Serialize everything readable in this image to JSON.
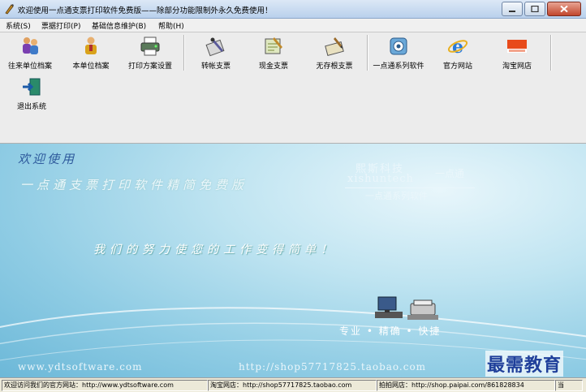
{
  "window": {
    "title": "欢迎使用一点通支票打印软件免费版——除部分功能限制外永久免费使用！"
  },
  "menu": [
    {
      "label": "系统(S)"
    },
    {
      "label": "票据打印(P)"
    },
    {
      "label": "基础信息维护(B)"
    },
    {
      "label": "帮助(H)"
    }
  ],
  "toolbar": {
    "buttons": [
      {
        "label": "往来单位档案",
        "icon": "people-icon"
      },
      {
        "label": "本单位档案",
        "icon": "person-icon"
      },
      {
        "label": "打印方案设置",
        "icon": "printer-settings-icon"
      },
      {
        "label": "转帐支票",
        "icon": "transfer-check-icon"
      },
      {
        "label": "现金支票",
        "icon": "cash-check-icon"
      },
      {
        "label": "无存根支票",
        "icon": "stubless-check-icon"
      },
      {
        "label": "一点通系列软件",
        "icon": "software-series-icon"
      },
      {
        "label": "官方网站",
        "icon": "ie-browser-icon"
      },
      {
        "label": "淘宝网店",
        "icon": "taobao-logo-icon"
      },
      {
        "label": "退出系统",
        "icon": "exit-door-icon"
      }
    ]
  },
  "banner": {
    "welcome": "欢迎使用",
    "subtitle": "一点通支票打印软件精简免费版",
    "brand_cn": "熙斯科技",
    "brand_en": "xishuntech",
    "brand_suffix": "一点通",
    "brand_series": "一点通系列软件",
    "slogan": "我们的努力使您的工作变得简单！",
    "tagline": "专业 • 精确 • 快捷",
    "url_site": "www.ydtsoftware.com",
    "url_shop": "http://shop57717825.taobao.com",
    "watermark": "最需教育"
  },
  "statusbar": {
    "panels": [
      "欢迎访问我们的官方网站：http://www.ydtsoftware.com",
      "淘宝网店：http://shop57717825.taobao.com",
      "拍拍网店：http://shop.paipai.com/861828834",
      "当"
    ]
  },
  "colors": {
    "accent": "#2e5a9c",
    "banner_light": "#e8f6fb",
    "banner_dark": "#6cb8d8",
    "watermark": "#1f3f9a"
  }
}
